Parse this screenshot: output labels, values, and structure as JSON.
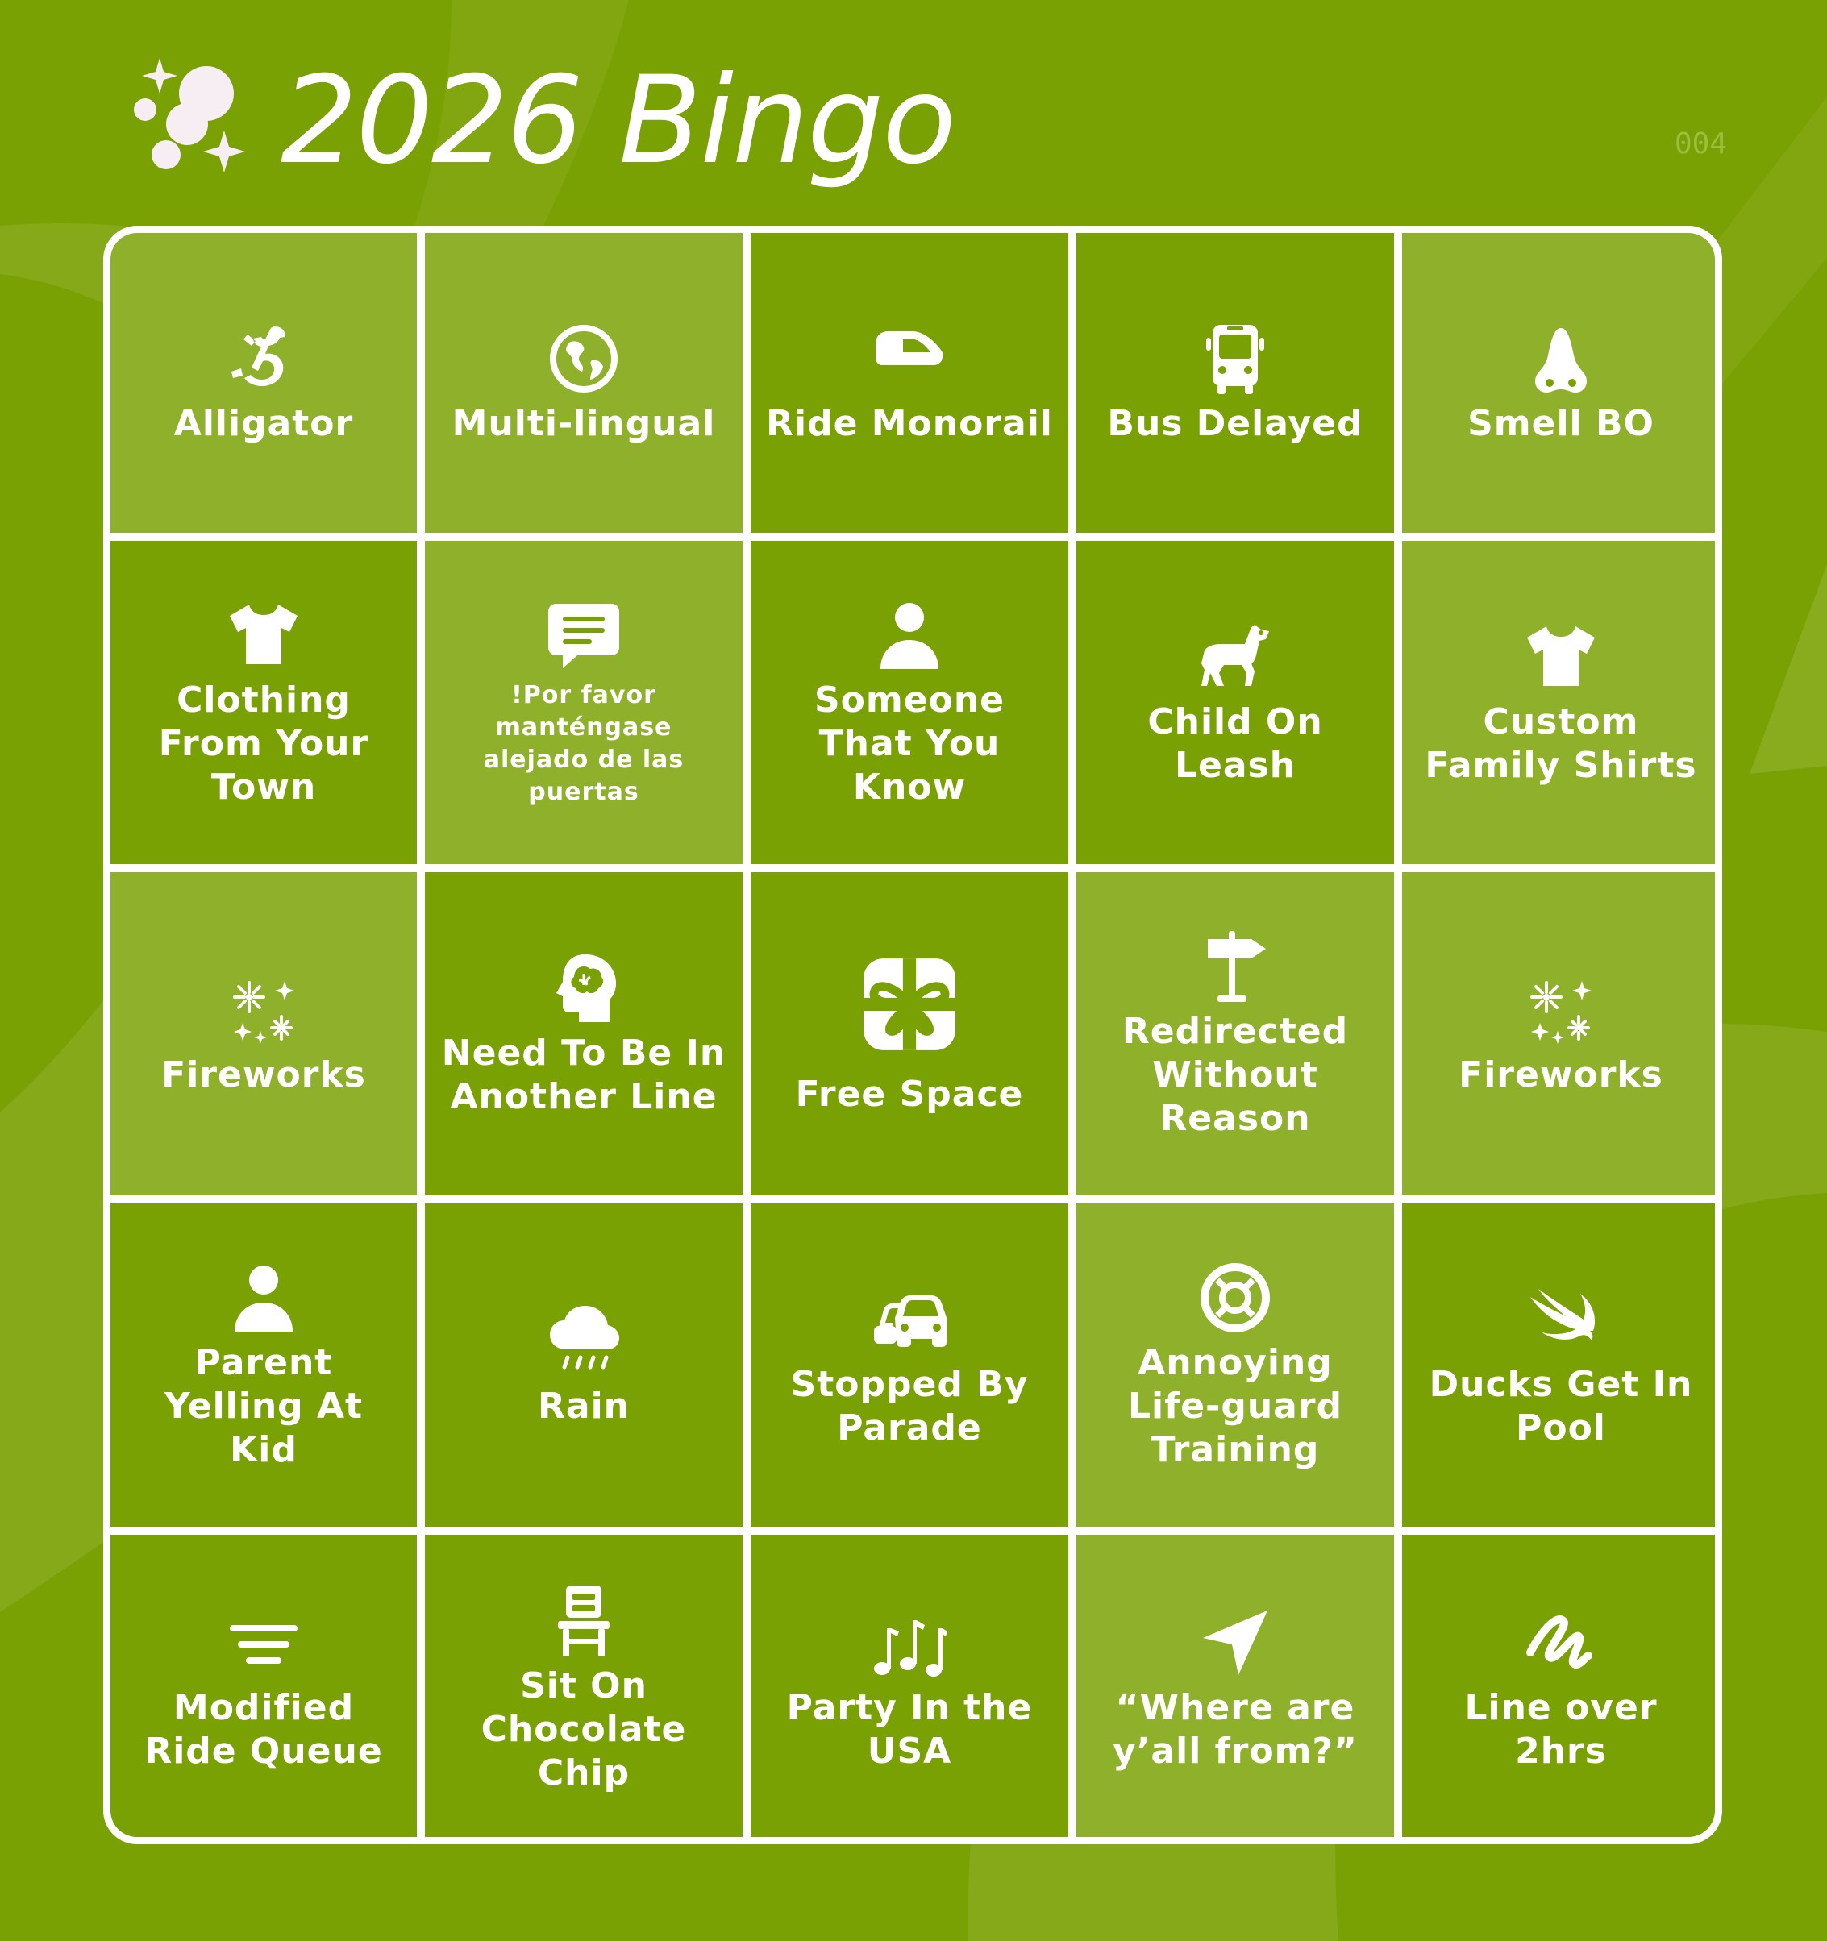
{
  "header": {
    "title": "2026 Bingo",
    "card_number": "004",
    "logo_icon": "sparkle-bubbles-icon"
  },
  "colors": {
    "background": "#7aa103",
    "cell_light": "#8fb02b",
    "cell_dark": "#7aa103",
    "grid_line": "#ffffff",
    "text": "#ffffff"
  },
  "board": {
    "rows": 5,
    "cols": 5,
    "cells": [
      {
        "label": "Alligator",
        "icon": "lizard-icon"
      },
      {
        "label": "Multi-lingual",
        "icon": "globe-icon"
      },
      {
        "label": "Ride Monorail",
        "icon": "train-icon"
      },
      {
        "label": "Bus Delayed",
        "icon": "bus-icon"
      },
      {
        "label": "Smell BO",
        "icon": "nose-icon"
      },
      {
        "label": "Clothing From Your Town",
        "icon": "tshirt-icon"
      },
      {
        "label": "!Por favor manténgase alejado de las puertas",
        "icon": "message-icon"
      },
      {
        "label": "Someone That You Know",
        "icon": "person-icon"
      },
      {
        "label": "Child On Leash",
        "icon": "dog-icon"
      },
      {
        "label": "Custom Family Shirts",
        "icon": "tshirt-icon"
      },
      {
        "label": "Fireworks",
        "icon": "fireworks-icon"
      },
      {
        "label": "Need To Be In Another Line",
        "icon": "head-brain-icon"
      },
      {
        "label": "Free Space",
        "icon": "gift-icon"
      },
      {
        "label": "Redirected Without Reason",
        "icon": "signpost-icon"
      },
      {
        "label": "Fireworks",
        "icon": "fireworks-icon"
      },
      {
        "label": "Parent Yelling At Kid",
        "icon": "person-icon"
      },
      {
        "label": "Rain",
        "icon": "cloud-rain-icon"
      },
      {
        "label": "Stopped By Parade",
        "icon": "cars-icon"
      },
      {
        "label": "Annoying Life-guard Training",
        "icon": "lifebuoy-icon"
      },
      {
        "label": "Ducks Get In Pool",
        "icon": "bird-icon"
      },
      {
        "label": "Modified Ride Queue",
        "icon": "lines-icon"
      },
      {
        "label": "Sit On Chocolate Chip",
        "icon": "chair-icon"
      },
      {
        "label": "Party In the USA",
        "icon": "music-notes-icon"
      },
      {
        "label": "“Where are y’all from?”",
        "icon": "location-arrow-icon"
      },
      {
        "label": "Line over 2hrs",
        "icon": "squiggle-icon"
      }
    ]
  }
}
